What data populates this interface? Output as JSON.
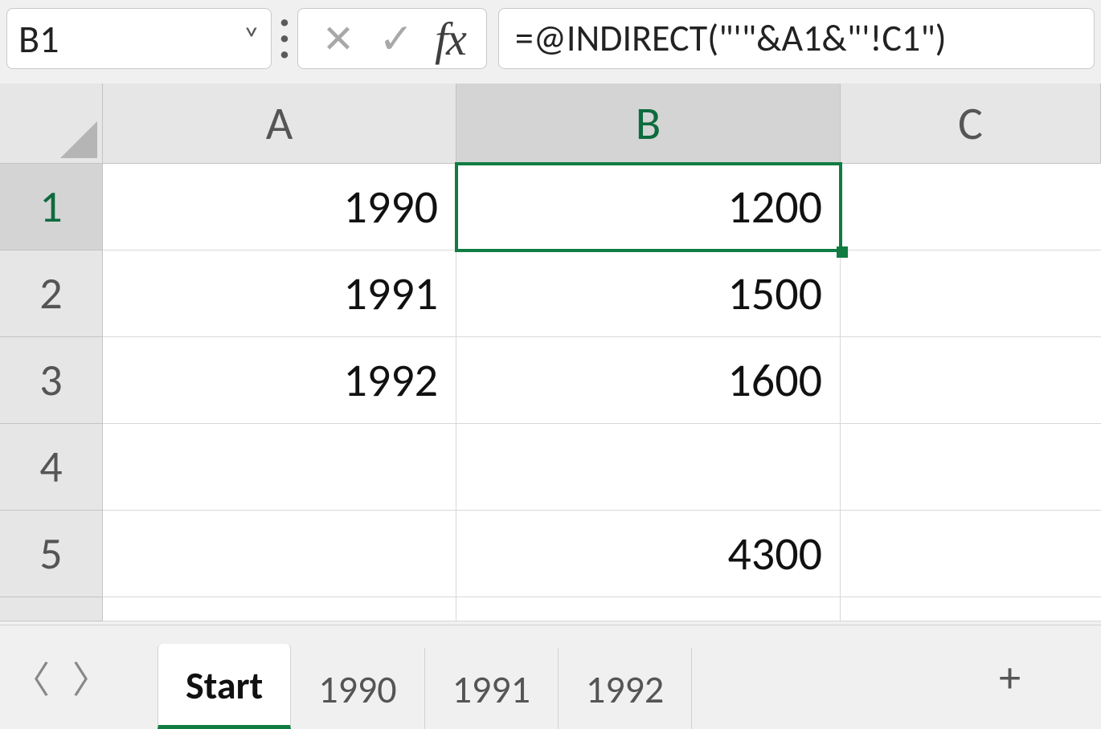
{
  "nameBox": {
    "value": "B1"
  },
  "formula": {
    "value": "=@INDIRECT(\"'\"&A1&\"'!C1\")"
  },
  "fx": {
    "label": "fx",
    "cancel": "✕",
    "enter": "✓"
  },
  "columns": [
    "A",
    "B",
    "C"
  ],
  "rowHeaders": [
    "1",
    "2",
    "3",
    "4",
    "5"
  ],
  "activeCol": "B",
  "activeRow": "1",
  "cells": {
    "r1": {
      "A": "1990",
      "B": "1200",
      "C": ""
    },
    "r2": {
      "A": "1991",
      "B": "1500",
      "C": ""
    },
    "r3": {
      "A": "1992",
      "B": "1600",
      "C": ""
    },
    "r4": {
      "A": "",
      "B": "",
      "C": ""
    },
    "r5": {
      "A": "",
      "B": "4300",
      "C": ""
    }
  },
  "sheets": {
    "active": "Start",
    "tabs": [
      "Start",
      "1990",
      "1991",
      "1992"
    ]
  },
  "icons": {
    "chevronDown": "˅",
    "prev": "〈",
    "next": "〉",
    "plus": "+"
  }
}
